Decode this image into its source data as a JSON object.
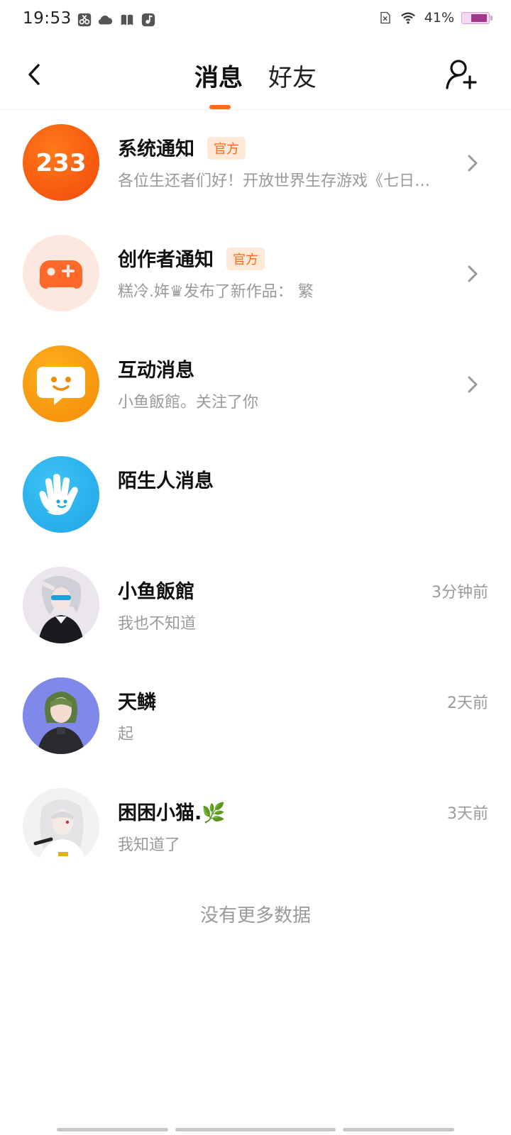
{
  "status_bar": {
    "time": "19:53",
    "battery_percent": "41%",
    "icons_left": [
      "scissors-icon",
      "cloud-icon",
      "book-icon",
      "music-icon"
    ],
    "icons_right": [
      "sim-error-icon",
      "wifi-icon",
      "battery-icon"
    ],
    "battery_color": "#a23a8c"
  },
  "header": {
    "back_icon": "chevron-left-icon",
    "tabs": [
      {
        "label": "消息",
        "active": true
      },
      {
        "label": "好友",
        "active": false
      }
    ],
    "add_friend_icon": "add-user-icon",
    "accent_color": "#ff6a13"
  },
  "messages": [
    {
      "title": "系统通知",
      "badge": "官方",
      "subtitle": "各位生还者们好！开放世界生存游戏《七日…",
      "avatar": "233-logo",
      "has_arrow": true
    },
    {
      "title": "创作者通知",
      "badge": "官方",
      "subtitle": "糕冷.姩♛发布了新作品：  繁",
      "avatar": "gamepad-icon",
      "has_arrow": true
    },
    {
      "title": "互动消息",
      "subtitle": "小鱼飯館。关注了你",
      "avatar": "chat-bubble-icon",
      "has_arrow": true
    },
    {
      "title": "陌生人消息",
      "subtitle": "",
      "avatar": "wave-hand-icon",
      "has_arrow": false
    },
    {
      "title": "小鱼飯館",
      "subtitle": "我也不知道",
      "time": "3分钟前",
      "avatar": "user-avatar"
    },
    {
      "title": "天鳞",
      "subtitle": "起",
      "time": "2天前",
      "avatar": "user-avatar"
    },
    {
      "title": "困困小猫.🌿",
      "subtitle": "我知道了",
      "time": "3天前",
      "avatar": "user-avatar"
    }
  ],
  "footer": {
    "no_more_text": "没有更多数据"
  }
}
